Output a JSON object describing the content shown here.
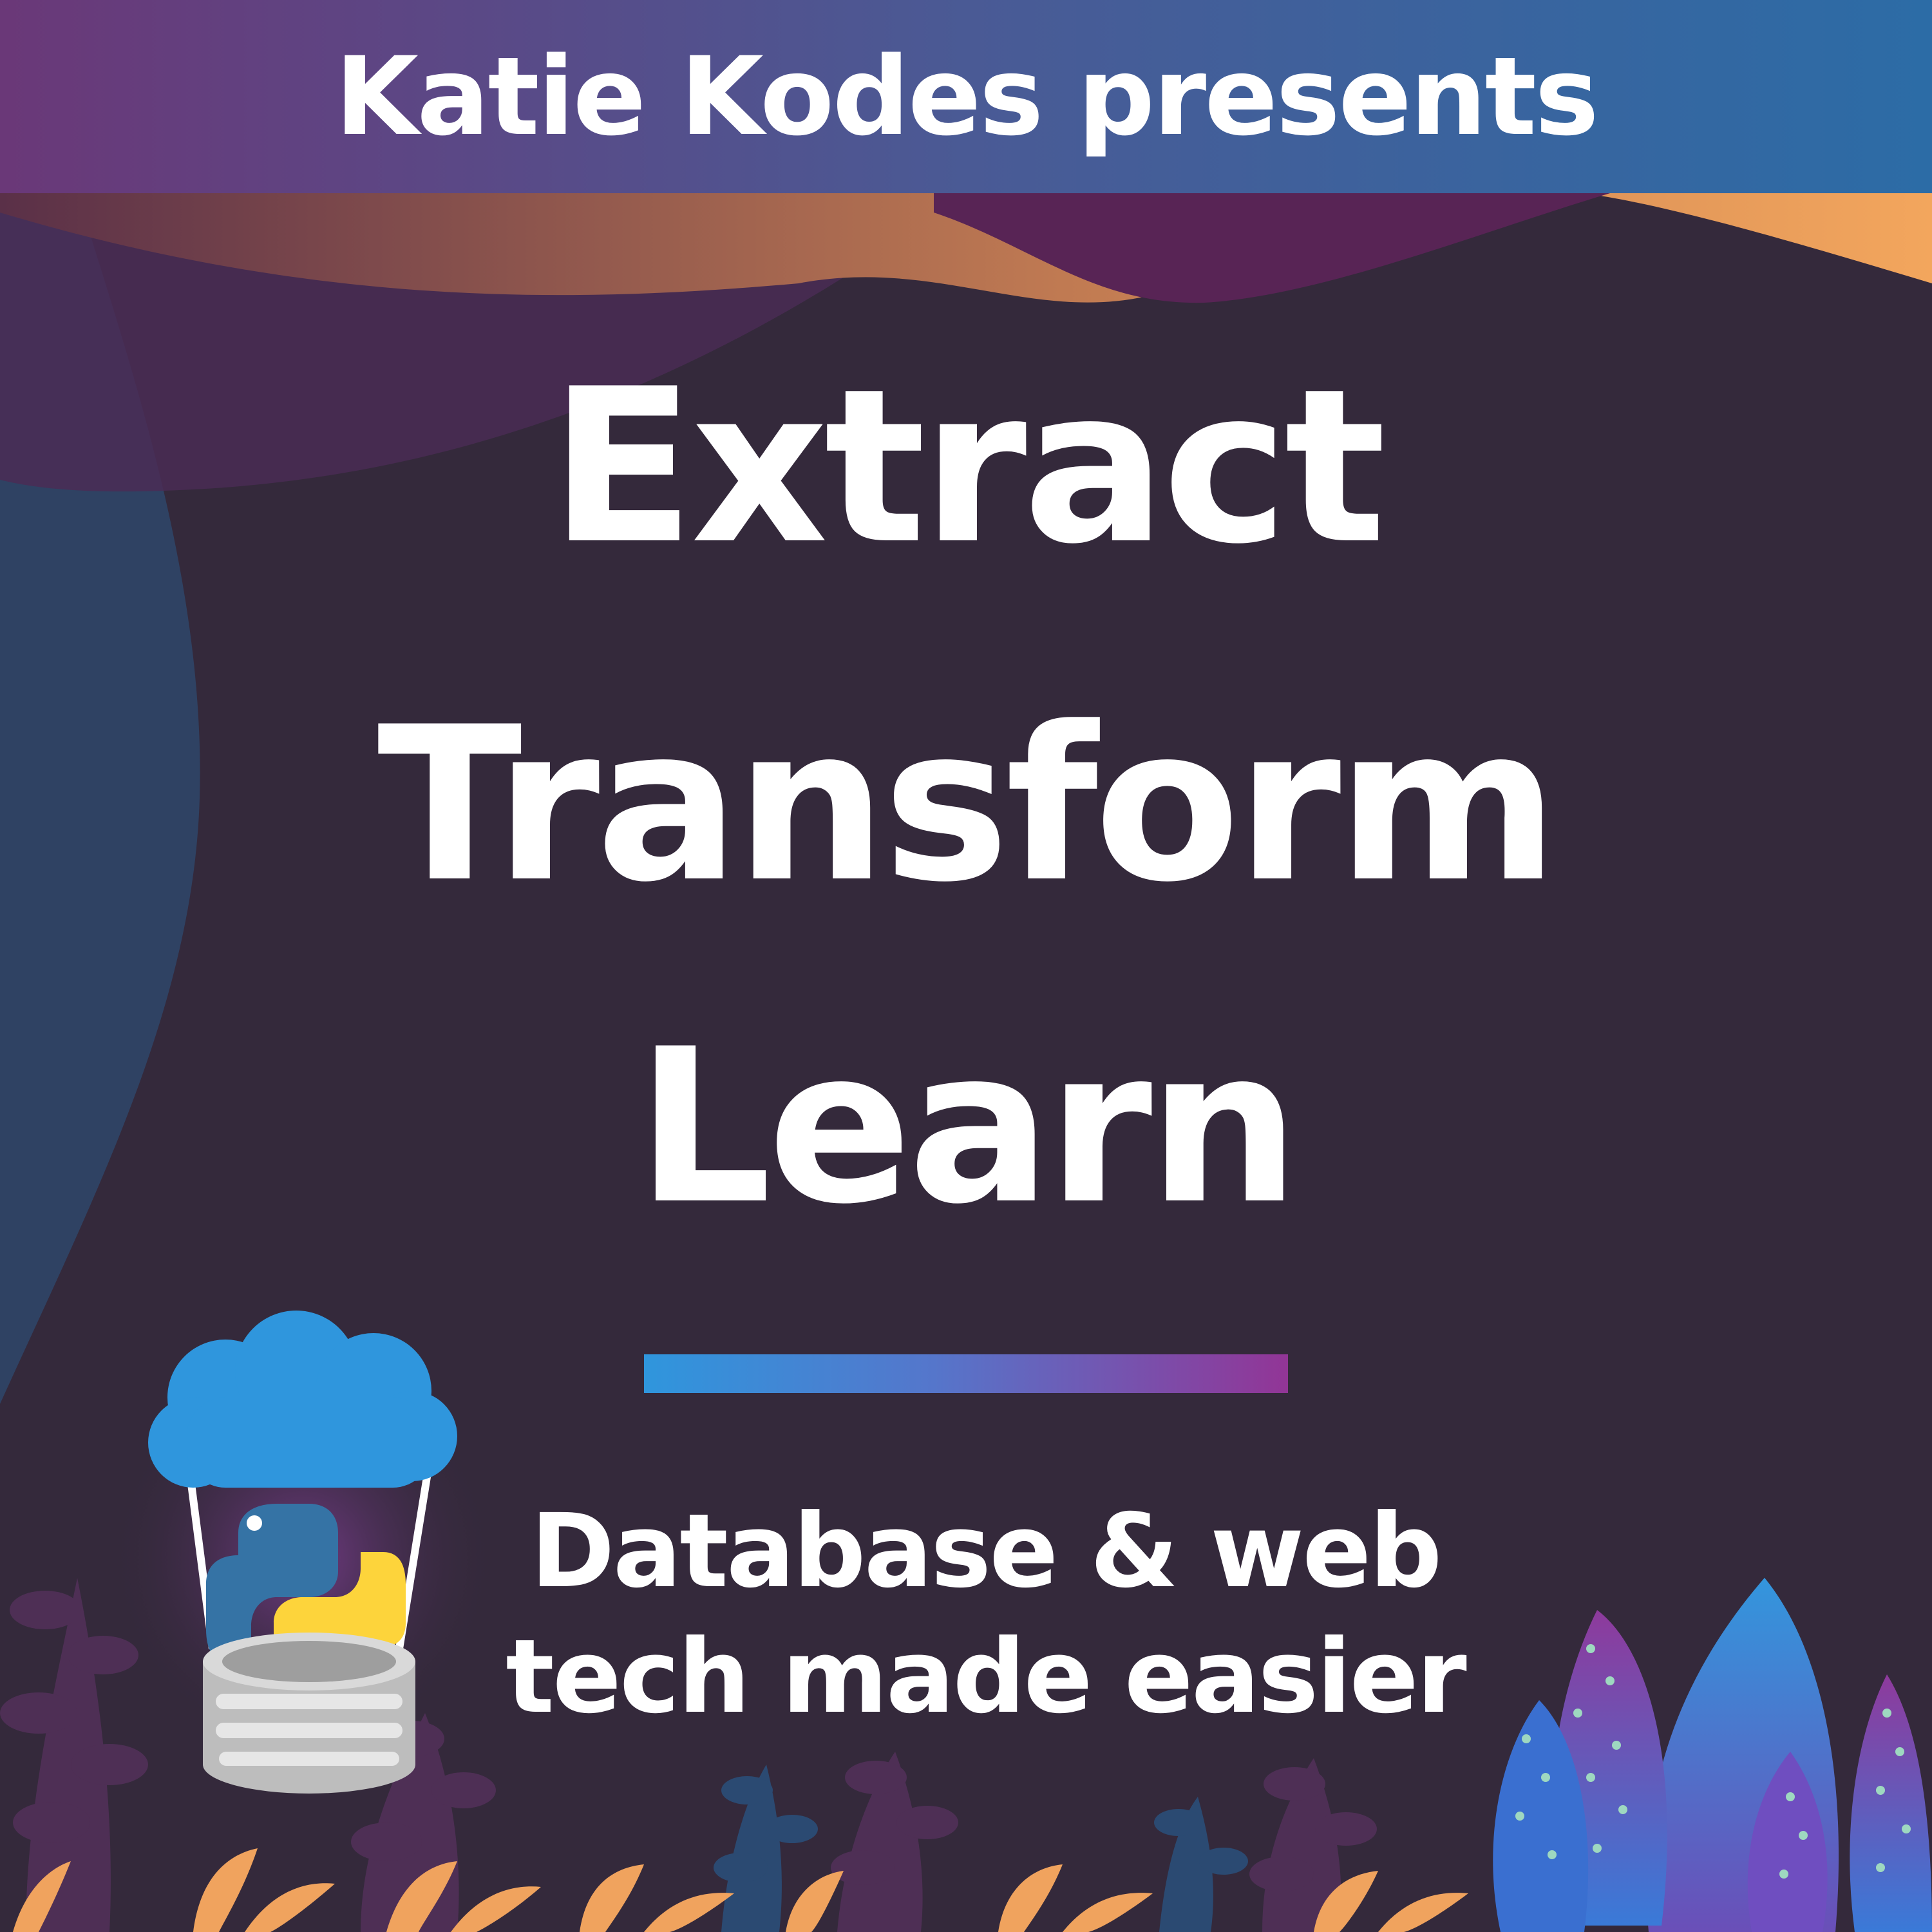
{
  "header": {
    "presenter_line": "Katie Kodes presents"
  },
  "title": {
    "line1": "Extract",
    "line2": "Transform",
    "line3": "Learn"
  },
  "tagline": {
    "line1": "Database & web",
    "line2": "tech made easier"
  },
  "colors": {
    "background": "#34293b",
    "banner_left": "#6a3878",
    "banner_right": "#2c6ca6",
    "divider_left": "#2f96dd",
    "divider_right": "#923596",
    "accent_orange": "#f0a35e",
    "cloud_blue": "#2f96dd",
    "python_blue": "#3573a5",
    "python_yellow": "#fdd43b"
  },
  "icons": {
    "logo": "cloud-balloon-database-icon",
    "python": "python-logo-icon",
    "plants": "foliage-decoration"
  }
}
